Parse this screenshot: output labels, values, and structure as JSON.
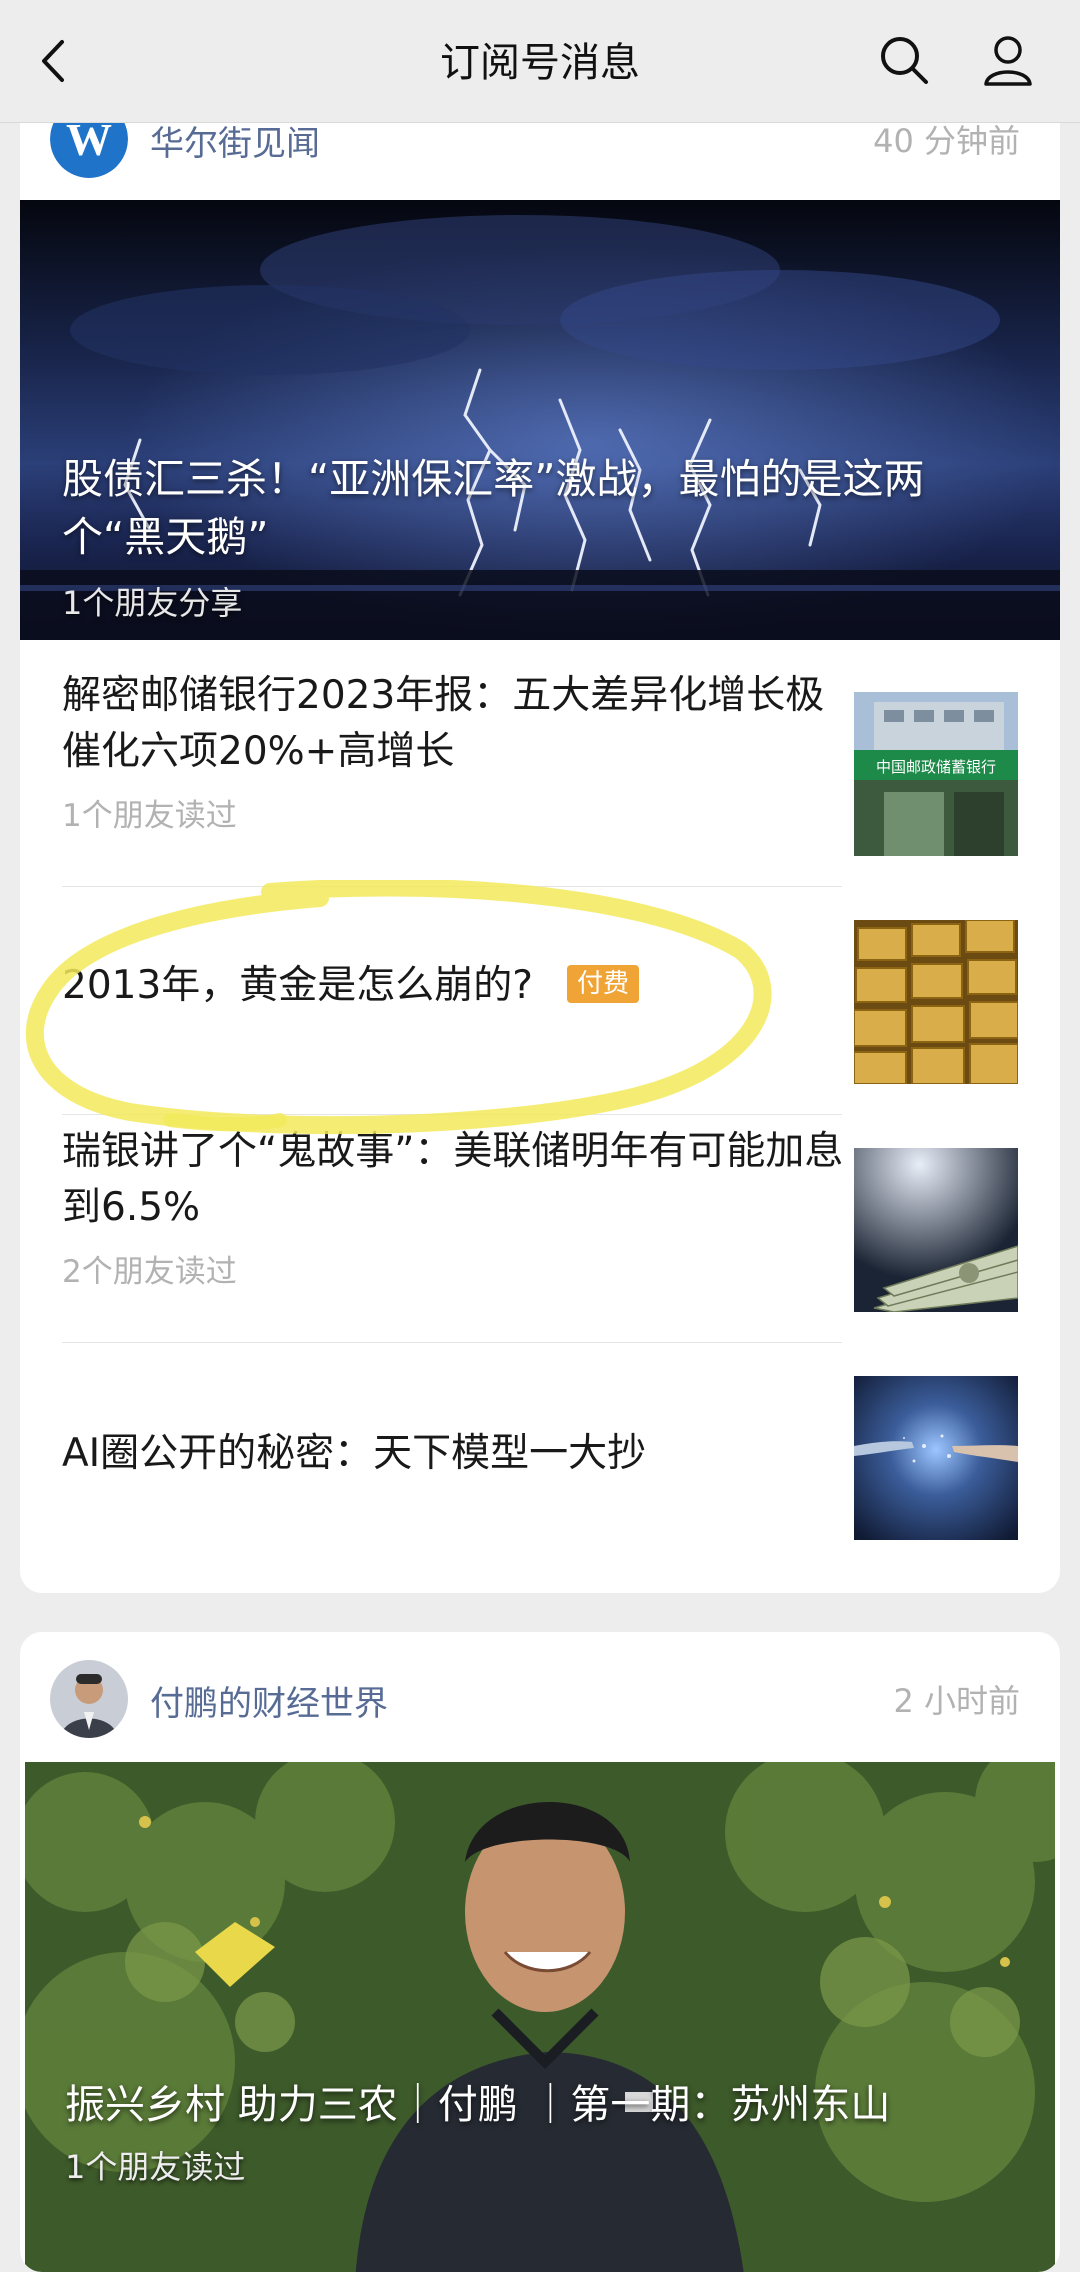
{
  "header": {
    "title": "订阅号消息",
    "back_icon": "chevron-left-icon",
    "search_icon": "search-icon",
    "profile_icon": "user-icon"
  },
  "account1": {
    "name": "华尔街见闻",
    "time": "40 分钟前",
    "avatar_letter": "W",
    "hero": {
      "title": "股债汇三杀！“亚洲保汇率”激战，最怕的是这两个“黑天鹅”",
      "friends": "1个朋友分享"
    },
    "articles": [
      {
        "title": "解密邮储银行2023年报：五大差异化增长极催化六项20%+高增长",
        "meta": "1个朋友读过",
        "badge": ""
      },
      {
        "title": "2013年，黄金是怎么崩的?",
        "meta": "",
        "badge": "付费"
      },
      {
        "title": "瑞银讲了个“鬼故事”：美联储明年有可能加息到6.5%",
        "meta": "2个朋友读过",
        "badge": ""
      },
      {
        "title": "AI圈公开的秘密：天下模型一大抄",
        "meta": "",
        "badge": ""
      }
    ]
  },
  "account2": {
    "name": "付鹏的财经世界",
    "time": "2 小时前",
    "hero": {
      "title": "振兴乡村 助力三农｜付鹏 ｜第一期：苏州东山",
      "friends": "1个朋友读过"
    }
  },
  "colors": {
    "accent_link": "#576b95",
    "badge": "#f0a436",
    "highlight": "#f3ea5a"
  }
}
